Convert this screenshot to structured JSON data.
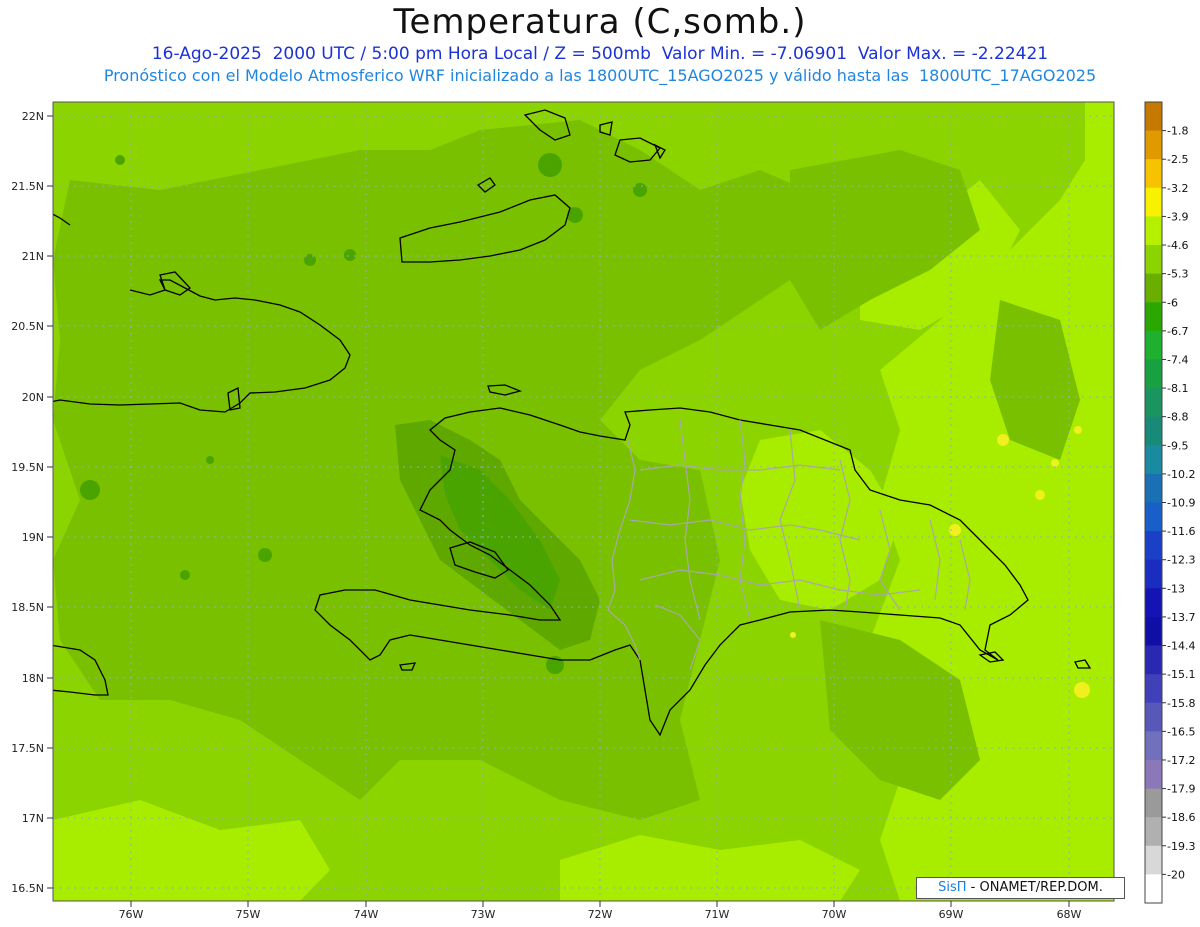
{
  "header": {
    "title": "Temperatura (C,somb.)",
    "line1": "16-Ago-2025  2000 UTC / 5:00 pm Hora Local / Z = 500mb  Valor Min. = -7.06901  Valor Max. = -2.22421",
    "line2": "Pronóstico con el Modelo Atmosferico WRF inicializado a las 1800UTC_15AGO2025 y válido hasta las  1800UTC_17AGO2025"
  },
  "map": {
    "lat_labels": [
      "22N",
      "21.5N",
      "21N",
      "20.5N",
      "20N",
      "19.5N",
      "19N",
      "18.5N",
      "18N",
      "17.5N",
      "17N",
      "16.5N"
    ],
    "lon_labels": [
      "76W",
      "75W",
      "74W",
      "73W",
      "72W",
      "71W",
      "70W",
      "69W",
      "68W"
    ]
  },
  "colorbar": {
    "levels": [
      "-1.8",
      "-2.5",
      "-3.2",
      "-3.9",
      "-4.6",
      "-5.3",
      "-6",
      "-6.7",
      "-7.4",
      "-8.1",
      "-8.8",
      "-9.5",
      "-10.2",
      "-10.9",
      "-11.6",
      "-12.3",
      "-13",
      "-13.7",
      "-14.4",
      "-15.1",
      "-15.8",
      "-16.5",
      "-17.2",
      "-17.9",
      "-18.6",
      "-19.3",
      "-20"
    ],
    "colors": [
      "#c47a00",
      "#e09a00",
      "#f7c200",
      "#f8f200",
      "#b4f000",
      "#8cd400",
      "#6aae00",
      "#2aa800",
      "#1fb030",
      "#19a040",
      "#1a9560",
      "#1a8a78",
      "#1a8aa0",
      "#1a70b4",
      "#1a5fc8",
      "#1a40c8",
      "#1a2dc0",
      "#1414b4",
      "#0f0fa8",
      "#2828b0",
      "#4040b8",
      "#5858b8",
      "#7070bc",
      "#8a78b8",
      "#9a9a9a",
      "#b0b0b0",
      "#d8d8d8",
      "#ffffff"
    ]
  },
  "credit": {
    "brand": "SisΠ",
    "text": "- ONAMET/REP.DOM."
  }
}
